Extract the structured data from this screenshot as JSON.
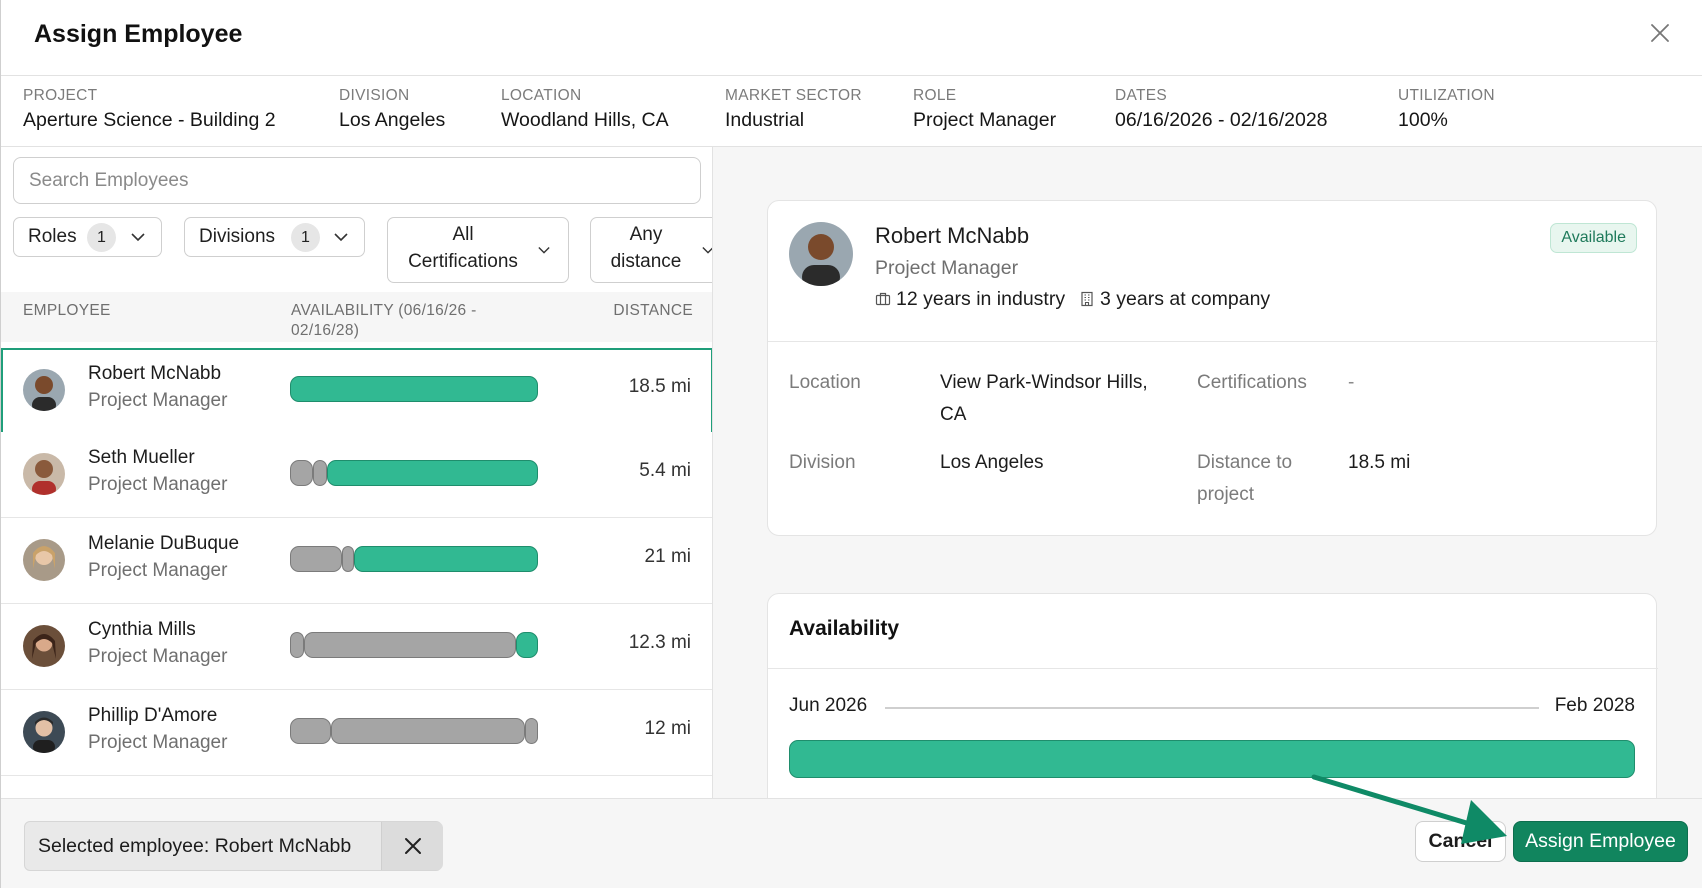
{
  "dialog": {
    "title": "Assign Employee"
  },
  "meta": [
    {
      "label": "PROJECT",
      "value": "Aperture Science - Building 2"
    },
    {
      "label": "DIVISION",
      "value": "Los Angeles"
    },
    {
      "label": "LOCATION",
      "value": "Woodland Hills, CA"
    },
    {
      "label": "MARKET SECTOR",
      "value": "Industrial"
    },
    {
      "label": "ROLE",
      "value": "Project Manager"
    },
    {
      "label": "DATES",
      "value": "06/16/2026 - 02/16/2028"
    },
    {
      "label": "UTILIZATION",
      "value": "100%"
    }
  ],
  "search": {
    "placeholder": "Search Employees"
  },
  "filters": {
    "roles": {
      "label": "Roles",
      "count": "1"
    },
    "divisions": {
      "label": "Divisions",
      "count": "1"
    },
    "certifications": {
      "line1": "All",
      "line2": "Certifications"
    },
    "distance": {
      "line1": "Any",
      "line2": "distance"
    }
  },
  "table": {
    "headers": {
      "employee": "EMPLOYEE",
      "availability_1": "AVAILABILITY (06/16/26 -",
      "availability_2": "02/16/28)",
      "distance": "DISTANCE"
    },
    "rows": [
      {
        "name": "Robert McNabb",
        "role": "Project Manager",
        "distance": "18.5 mi",
        "selected": true
      },
      {
        "name": "Seth Mueller",
        "role": "Project Manager",
        "distance": "5.4 mi"
      },
      {
        "name": "Melanie DuBuque",
        "role": "Project Manager",
        "distance": "21 mi"
      },
      {
        "name": "Cynthia Mills",
        "role": "Project Manager",
        "distance": "12.3 mi"
      },
      {
        "name": "Phillip D'Amore",
        "role": "Project Manager",
        "distance": "12 mi"
      }
    ]
  },
  "detail": {
    "name": "Robert McNabb",
    "role": "Project Manager",
    "status": "Available",
    "industry_years": "12 years in industry",
    "company_years": "3 years at company",
    "fields": {
      "location_label": "Location",
      "location_value_1": "View Park-Windsor Hills,",
      "location_value_2": "CA",
      "certifications_label": "Certifications",
      "certifications_value": "-",
      "division_label": "Division",
      "division_value": "Los Angeles",
      "distance_label_1": "Distance to",
      "distance_label_2": "project",
      "distance_value": "18.5 mi"
    }
  },
  "availability": {
    "title": "Availability",
    "start": "Jun 2026",
    "end": "Feb 2028"
  },
  "footer": {
    "selected": "Selected employee: Robert McNabb",
    "cancel": "Cancel",
    "assign": "Assign Employee"
  },
  "colors": {
    "accent": "#11855e",
    "available": "#31b992",
    "unavailable": "#a5a5a5"
  }
}
